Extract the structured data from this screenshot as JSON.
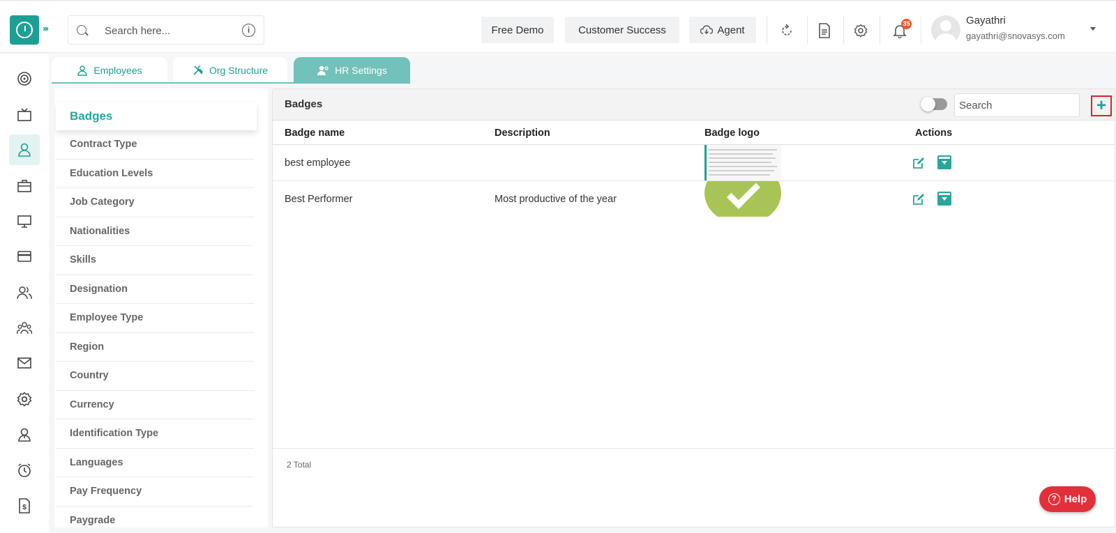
{
  "header": {
    "search_placeholder": "Search here...",
    "buttons": {
      "free_demo": "Free Demo",
      "customer_success": "Customer Success",
      "agent": "Agent"
    },
    "notification_count": "35",
    "user": {
      "name": "Gayathri",
      "email": "gayathri@snovasys.com"
    }
  },
  "tabs": [
    {
      "label": "Employees"
    },
    {
      "label": "Org Structure"
    },
    {
      "label": "HR Settings"
    }
  ],
  "menu": {
    "items": [
      "Badges",
      "Contract Type",
      "Education Levels",
      "Job Category",
      "Nationalities",
      "Skills",
      "Designation",
      "Employee Type",
      "Region",
      "Country",
      "Currency",
      "Identification Type",
      "Languages",
      "Pay Frequency",
      "Paygrade"
    ]
  },
  "panel": {
    "title": "Badges",
    "search_placeholder": "Search",
    "add_label": "+",
    "columns": {
      "name": "Badge name",
      "description": "Description",
      "logo": "Badge logo",
      "actions": "Actions"
    },
    "rows": [
      {
        "name": "best employee",
        "description": ""
      },
      {
        "name": "Best Performer",
        "description": "Most productive of the year"
      }
    ],
    "total": "2 Total"
  },
  "help": {
    "label": "Help"
  },
  "colors": {
    "accent": "#1e9f96",
    "tab_active": "#72c1bb",
    "help": "#e2303a",
    "highlight": "#e0202a"
  }
}
